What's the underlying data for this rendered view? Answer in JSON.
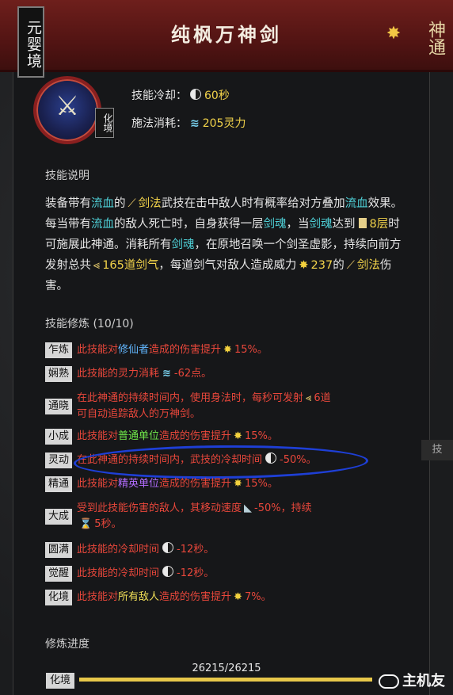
{
  "header": {
    "realm": "元婴境",
    "title": "纯枫万神剑",
    "seal_text": "神通"
  },
  "skill": {
    "tier": "化境",
    "cooldown_label": "技能冷却：",
    "cooldown_value": "60秒",
    "cost_label": "施法消耗：",
    "cost_value": "205灵力"
  },
  "description": {
    "heading": "技能说明",
    "p1": "装备带有",
    "bleed": "流血",
    "p2": "的",
    "sword_style": "剑法",
    "p3": "武技在击中敌人时有概率给对方叠加",
    "bleed2": "流血",
    "p4": "效果。每当带有",
    "bleed3": "流血",
    "p5": "的敌人死亡时，自身获得一层",
    "soul": "剑魂",
    "p6": "，当",
    "soul2": "剑魂",
    "p7": "达到",
    "layers": "8层",
    "p8": "时可施展此神通。消耗所有",
    "soul3": "剑魂",
    "p9": "，在原地召唤一个剑圣虚影，持续向前方发射总共",
    "qi_count": "165道剑气",
    "p10": "，每道剑气对敌人造成威力",
    "power": "237",
    "p11": "的",
    "sword_style2": "剑法",
    "p12": "伤害。"
  },
  "cultivation": {
    "heading": "技能修炼 (10/10)",
    "rows": [
      {
        "tag": "乍炼",
        "a": "此技能对",
        "hl": "修仙者",
        "b": "造成的伤害提升",
        "v": "15%。"
      },
      {
        "tag": "娴熟",
        "a": "此技能的灵力消耗",
        "v": "-62点。"
      },
      {
        "tag": "通晓",
        "a": "在此神通的持续时间内，使用身法时，每秒可发射",
        "v": "6道",
        "b": "可自动追踪敌人的万神剑。"
      },
      {
        "tag": "小成",
        "a": "此技能对",
        "hl": "普通单位",
        "b": "造成的伤害提升",
        "v": "15%。"
      },
      {
        "tag": "灵动",
        "a": "在此神通的持续时间内，武技的冷却时间",
        "v": "-50%。"
      },
      {
        "tag": "精通",
        "a": "此技能对",
        "hl": "精英单位",
        "b": "造成的伤害提升",
        "v": "15%。"
      },
      {
        "tag": "大成",
        "a": "受到此技能伤害的敌人，其移动速度",
        "v": "-50%，持续",
        "b": "5秒。"
      },
      {
        "tag": "圆满",
        "a": "此技能的冷却时间",
        "v": "-12秒。"
      },
      {
        "tag": "觉醒",
        "a": "此技能的冷却时间",
        "v": "-12秒。"
      },
      {
        "tag": "化境",
        "a": "此技能对",
        "hl": "所有敌人",
        "b": "造成的伤害提升",
        "v": "7%。"
      }
    ]
  },
  "progress": {
    "heading": "修炼进度",
    "text": "26215/26215",
    "fraction": 1.0,
    "tag": "化境"
  },
  "side": {
    "tab": "技"
  },
  "watermark": "主机友"
}
